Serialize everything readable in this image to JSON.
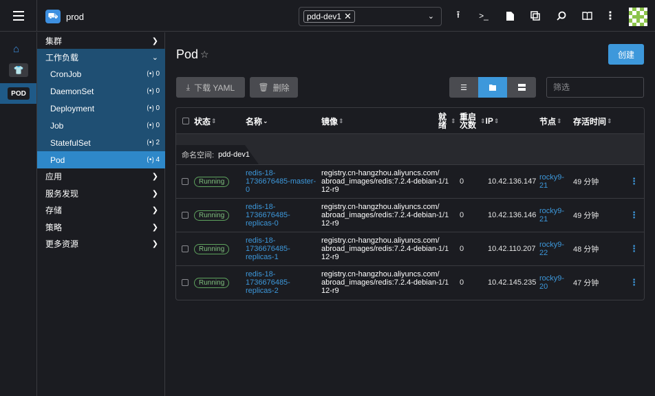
{
  "topbar": {
    "cluster_name": "prod",
    "namespace_chip": "pdd-dev1",
    "icons": [
      "upload-icon",
      "terminal-icon",
      "file-icon",
      "copy-icon",
      "search-icon",
      "book-icon",
      "more-vert-icon"
    ]
  },
  "rail": {
    "pod_label": "POD"
  },
  "menu": {
    "cluster": "集群",
    "workloads": "工作负载",
    "sub": [
      {
        "label": "CronJob",
        "count": "0"
      },
      {
        "label": "DaemonSet",
        "count": "0"
      },
      {
        "label": "Deployment",
        "count": "0"
      },
      {
        "label": "Job",
        "count": "0"
      },
      {
        "label": "StatefulSet",
        "count": "2"
      },
      {
        "label": "Pod",
        "count": "4"
      }
    ],
    "apps": "应用",
    "service_discovery": "服务发现",
    "storage": "存储",
    "policy": "策略",
    "more_resources": "更多资源"
  },
  "main": {
    "title": "Pod",
    "create": "创建",
    "download_yaml": "下载 YAML",
    "delete": "删除",
    "filter_placeholder": "筛选"
  },
  "table": {
    "headers": {
      "status": "状态",
      "name": "名称",
      "image": "镜像",
      "ready_1": "就",
      "ready_2": "绪",
      "restarts_1": "重启",
      "restarts_2": "次数",
      "ip": "IP",
      "node": "节点",
      "age": "存活时间"
    },
    "group_label": "命名空间:",
    "group_value": "pdd-dev1",
    "rows": [
      {
        "status": "Running",
        "name": [
          "redis-18-",
          "1736676485-master-",
          "0"
        ],
        "image": [
          "registry.cn-hangzhou.aliyuncs.com/",
          "abroad_images/redis:7.2.4-debian-",
          "12-r9"
        ],
        "ready": "1/1",
        "restarts": "0",
        "ip": "10.42.136.147",
        "node": [
          "rocky9-",
          "21"
        ],
        "age": "49 分钟"
      },
      {
        "status": "Running",
        "name": [
          "redis-18-",
          "1736676485-",
          "replicas-0"
        ],
        "image": [
          "registry.cn-hangzhou.aliyuncs.com/",
          "abroad_images/redis:7.2.4-debian-",
          "12-r9"
        ],
        "ready": "1/1",
        "restarts": "0",
        "ip": "10.42.136.146",
        "node": [
          "rocky9-",
          "21"
        ],
        "age": "49 分钟"
      },
      {
        "status": "Running",
        "name": [
          "redis-18-",
          "1736676485-",
          "replicas-1"
        ],
        "image": [
          "registry.cn-hangzhou.aliyuncs.com/",
          "abroad_images/redis:7.2.4-debian-",
          "12-r9"
        ],
        "ready": "1/1",
        "restarts": "0",
        "ip": "10.42.110.207",
        "node": [
          "rocky9-",
          "22"
        ],
        "age": "48 分钟"
      },
      {
        "status": "Running",
        "name": [
          "redis-18-",
          "1736676485-",
          "replicas-2"
        ],
        "image": [
          "registry.cn-hangzhou.aliyuncs.com/",
          "abroad_images/redis:7.2.4-debian-",
          "12-r9"
        ],
        "ready": "1/1",
        "restarts": "0",
        "ip": "10.42.145.235",
        "node": [
          "rocky9-",
          "20"
        ],
        "age": "47 分钟"
      }
    ]
  },
  "colors": {
    "accent": "#3d98db",
    "menu_group": "#1f4f73",
    "running": "#7fbf7d"
  }
}
